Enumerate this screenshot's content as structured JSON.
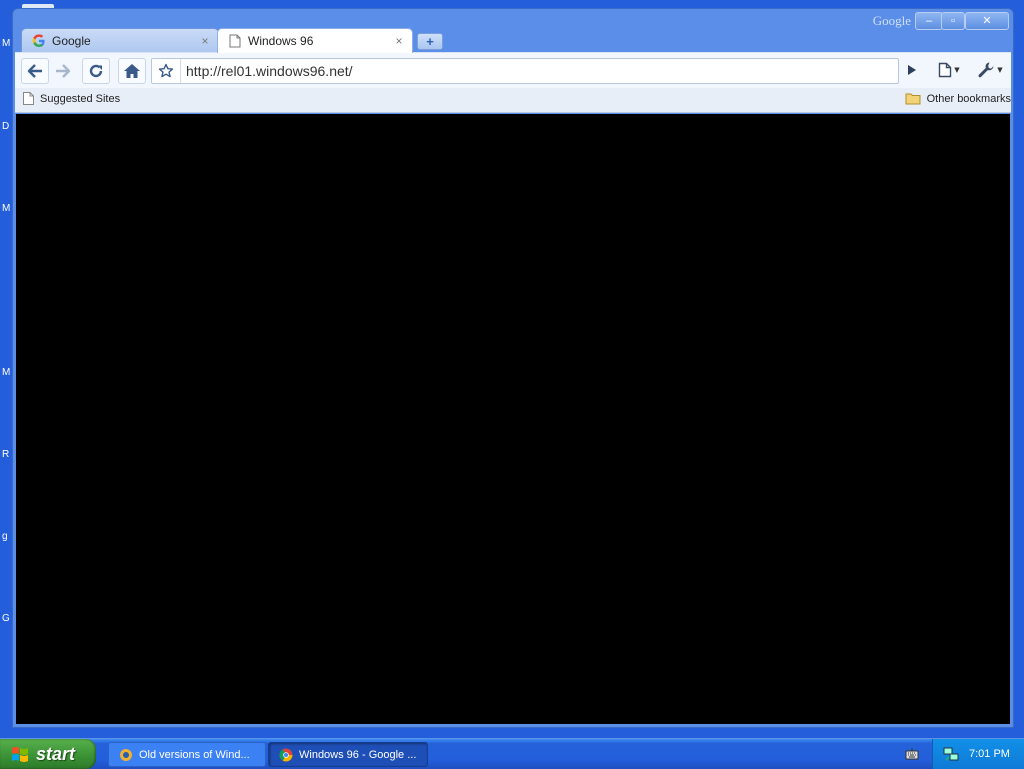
{
  "desktop": {
    "icon_letters": [
      "M",
      "D",
      "M",
      "M",
      "R",
      "g",
      "G"
    ]
  },
  "window": {
    "title_brand": "Google",
    "controls": {
      "minimize": "–",
      "maximize": "▫",
      "close": "✕"
    }
  },
  "tabs": [
    {
      "label": "Google",
      "icon": "google-g-icon",
      "active": false,
      "close": "×"
    },
    {
      "label": "Windows 96",
      "icon": "page-icon",
      "active": true,
      "close": "×"
    }
  ],
  "new_tab_label": "+",
  "toolbar": {
    "back_icon": "back-arrow-icon",
    "forward_icon": "forward-arrow-icon",
    "reload_icon": "reload-icon",
    "home_icon": "home-icon",
    "url": "http://rel01.windows96.net/",
    "go_icon": "play-icon",
    "page_menu_icon": "page-menu-icon",
    "wrench_menu_icon": "wrench-icon"
  },
  "bookmarks": {
    "left": "Suggested Sites",
    "right": "Other bookmarks"
  },
  "content": {
    "background": "#000000"
  },
  "taskbar": {
    "start_label": "start",
    "tasks": [
      {
        "label": "Old versions of Wind...",
        "active": false
      },
      {
        "label": "Windows 96 - Google ...",
        "active": true
      }
    ],
    "clock": "7:01 PM"
  },
  "colors": {
    "desktop": "#245edb",
    "taskbar": "#245edb",
    "start_button": "#3a9034",
    "tray": "#0e7ad6"
  }
}
